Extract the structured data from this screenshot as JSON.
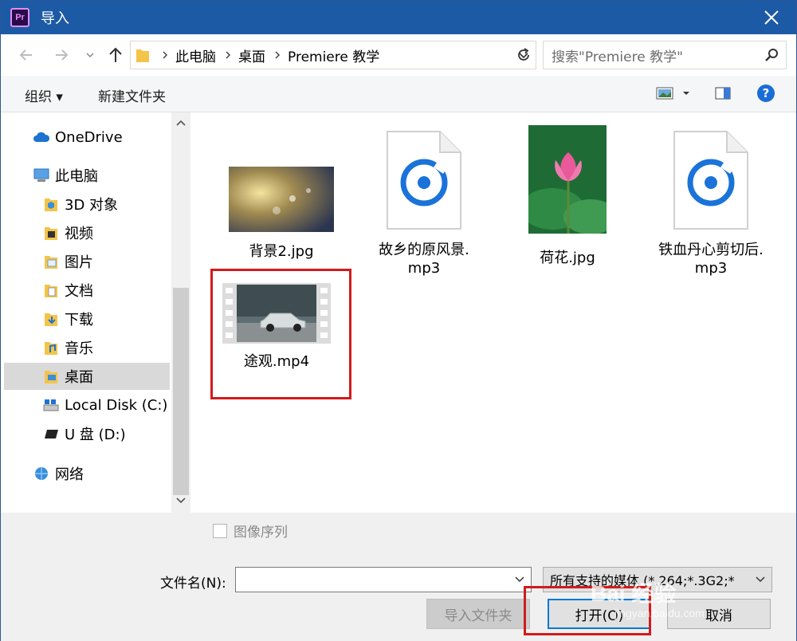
{
  "titlebar": {
    "app_icon": "Pr",
    "title": "导入"
  },
  "address": {
    "segments": [
      "此电脑",
      "桌面",
      "Premiere 教学"
    ],
    "search_placeholder": "搜索\"Premiere 教学\""
  },
  "toolbar": {
    "organize": "组织 ▾",
    "new_folder": "新建文件夹"
  },
  "nav": {
    "items": [
      {
        "label": "OneDrive",
        "icon": "cloud-icon"
      },
      {
        "label": "此电脑",
        "icon": "computer-icon"
      },
      {
        "label": "3D 对象",
        "icon": "folder-3d-icon"
      },
      {
        "label": "视频",
        "icon": "folder-video-icon"
      },
      {
        "label": "图片",
        "icon": "folder-pictures-icon"
      },
      {
        "label": "文档",
        "icon": "folder-documents-icon"
      },
      {
        "label": "下载",
        "icon": "folder-downloads-icon"
      },
      {
        "label": "音乐",
        "icon": "folder-music-icon"
      },
      {
        "label": "桌面",
        "icon": "folder-desktop-icon",
        "selected": true
      },
      {
        "label": "Local Disk (C:)",
        "icon": "drive-icon"
      },
      {
        "label": "U 盘 (D:)",
        "icon": "usb-drive-icon"
      },
      {
        "label": "网络",
        "icon": "network-icon"
      }
    ]
  },
  "files": [
    {
      "line1": "背景2.jpg",
      "line2": "",
      "type": "image"
    },
    {
      "line1": "故乡的原风景.",
      "line2": "mp3",
      "type": "audio"
    },
    {
      "line1": "荷花.jpg",
      "line2": "",
      "type": "image"
    },
    {
      "line1": "铁血丹心剪切后.",
      "line2": "mp3",
      "type": "audio"
    },
    {
      "line1": "途观.mp4",
      "line2": "",
      "type": "video"
    }
  ],
  "bottom": {
    "image_sequence": "图像序列",
    "filename_label": "文件名(N):",
    "filename_value": "",
    "filter": "所有支持的媒体 (*.264;*.3G2;*",
    "import_folder": "导入文件夹",
    "open": "打开(O)",
    "cancel": "取消"
  },
  "watermark": {
    "text": "Bai 经验",
    "url": "jingyan.baidu.com"
  },
  "colors": {
    "titlebar": "#1c5aa6",
    "accent": "#0078d7",
    "highlight": "#d11b1b"
  }
}
